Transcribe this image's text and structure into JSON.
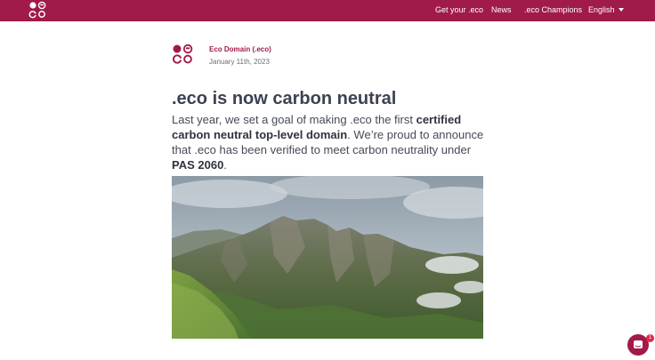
{
  "brand": {
    "name": "eco",
    "color": "#a01a4a"
  },
  "nav": {
    "get": "Get your .eco",
    "news": "News",
    "champions": ".eco Champions",
    "language": "English"
  },
  "post": {
    "author": "Eco Domain (.eco)",
    "date": "January 11th, 2023",
    "title": ".eco is now carbon neutral",
    "lead": {
      "p1": "Last year, we set a goal of making .eco the first ",
      "b1": "certified carbon neutral top-level domain",
      "p2": ". We’re proud to announce that .eco has been verified to meet carbon neutrality under ",
      "b2": "PAS 2060",
      "p3": "."
    },
    "image_subject": "mountain-landscape"
  },
  "chat": {
    "badge": "1",
    "icon": "chat-icon"
  }
}
